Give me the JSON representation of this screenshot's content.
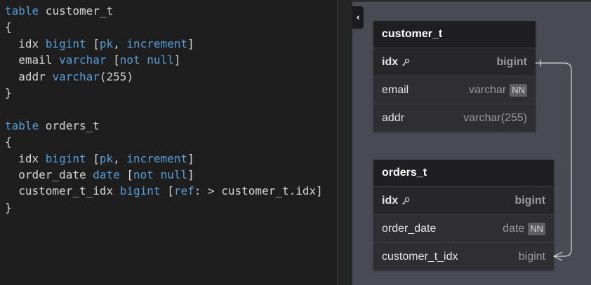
{
  "editor": {
    "lines": [
      [
        {
          "t": "table",
          "c": "kw"
        },
        {
          "t": " customer_t",
          "c": ""
        }
      ],
      [
        {
          "t": "{",
          "c": ""
        }
      ],
      [
        {
          "t": "  idx ",
          "c": ""
        },
        {
          "t": "bigint",
          "c": "kw"
        },
        {
          "t": " [",
          "c": ""
        },
        {
          "t": "pk",
          "c": "kw"
        },
        {
          "t": ", ",
          "c": ""
        },
        {
          "t": "increment",
          "c": "kw"
        },
        {
          "t": "]",
          "c": ""
        }
      ],
      [
        {
          "t": "  email ",
          "c": ""
        },
        {
          "t": "varchar",
          "c": "kw"
        },
        {
          "t": " [",
          "c": ""
        },
        {
          "t": "not null",
          "c": "kw"
        },
        {
          "t": "]",
          "c": ""
        }
      ],
      [
        {
          "t": "  addr ",
          "c": ""
        },
        {
          "t": "varchar",
          "c": "kw"
        },
        {
          "t": "(255)",
          "c": ""
        }
      ],
      [
        {
          "t": "}",
          "c": ""
        }
      ],
      [
        {
          "t": "",
          "c": ""
        }
      ],
      [
        {
          "t": "table",
          "c": "kw"
        },
        {
          "t": " orders_t",
          "c": ""
        }
      ],
      [
        {
          "t": "{",
          "c": ""
        }
      ],
      [
        {
          "t": "  idx ",
          "c": ""
        },
        {
          "t": "bigint",
          "c": "kw"
        },
        {
          "t": " [",
          "c": ""
        },
        {
          "t": "pk",
          "c": "kw"
        },
        {
          "t": ", ",
          "c": ""
        },
        {
          "t": "increment",
          "c": "kw"
        },
        {
          "t": "]",
          "c": ""
        }
      ],
      [
        {
          "t": "  order_date ",
          "c": ""
        },
        {
          "t": "date",
          "c": "kw"
        },
        {
          "t": " [",
          "c": ""
        },
        {
          "t": "not null",
          "c": "kw"
        },
        {
          "t": "]",
          "c": ""
        }
      ],
      [
        {
          "t": "  customer_t_idx ",
          "c": ""
        },
        {
          "t": "bigint",
          "c": "kw"
        },
        {
          "t": " [",
          "c": ""
        },
        {
          "t": "ref",
          "c": "kw"
        },
        {
          "t": ": > customer_t.idx]",
          "c": ""
        }
      ],
      [
        {
          "t": "}",
          "c": ""
        }
      ]
    ]
  },
  "diagram": {
    "collapse_glyph": "‹",
    "tables": [
      {
        "name": "customer_t",
        "rows": [
          {
            "name": "idx",
            "type": "bigint",
            "pk": true,
            "nn": ""
          },
          {
            "name": "email",
            "type": "varchar",
            "pk": false,
            "nn": "NN"
          },
          {
            "name": "addr",
            "type": "varchar(255)",
            "pk": false,
            "nn": ""
          }
        ]
      },
      {
        "name": "orders_t",
        "rows": [
          {
            "name": "idx",
            "type": "bigint",
            "pk": true,
            "nn": ""
          },
          {
            "name": "order_date",
            "type": "date",
            "pk": false,
            "nn": "NN"
          },
          {
            "name": "customer_t_idx",
            "type": "bigint",
            "pk": false,
            "nn": ""
          }
        ]
      }
    ]
  },
  "colors": {
    "keyword": "#569cd6",
    "text": "#d4d4d4",
    "canvas": "#4a4a55"
  }
}
